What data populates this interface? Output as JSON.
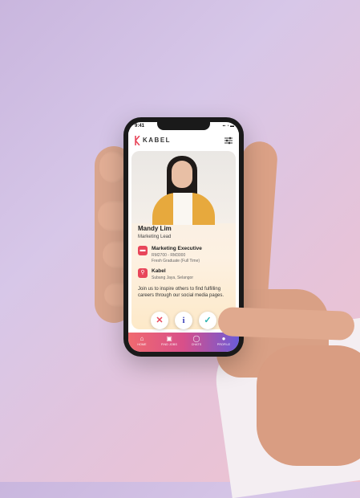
{
  "status_bar": {
    "time": "9:41",
    "icons": "▪▪ ◔ ▬"
  },
  "header": {
    "logo_text": "KABEL",
    "logo_icon": "kabel-logo-icon",
    "filter_icon": "filter-sliders-icon"
  },
  "profile": {
    "name": "Mandy Lim",
    "role": "Marketing Lead",
    "job": {
      "icon": "briefcase-icon",
      "title": "Marketing Executive",
      "salary": "RM2700 - RM3000",
      "type": "Fresh Graduate (Full Time)"
    },
    "company": {
      "icon": "location-pin-icon",
      "name": "Kabel",
      "location": "Subang Jaya, Selangor"
    },
    "description": "Join us to inspire others to find fulfilling careers through our social media pages."
  },
  "actions": [
    {
      "name": "reject",
      "glyph": "✕",
      "color": "#e8465a"
    },
    {
      "name": "info",
      "glyph": "i",
      "color": "#3a3fb8"
    },
    {
      "name": "accept",
      "glyph": "✓",
      "color": "#2bb3b0"
    }
  ],
  "nav": [
    {
      "label": "HOME",
      "icon": "home-icon",
      "glyph": "⌂"
    },
    {
      "label": "FIND JOBS",
      "icon": "find-jobs-icon",
      "glyph": "▣"
    },
    {
      "label": "CHATS",
      "icon": "chat-icon",
      "glyph": "◯"
    },
    {
      "label": "PROFILE",
      "icon": "profile-icon",
      "glyph": "●"
    }
  ],
  "colors": {
    "accent": "#e8465a",
    "nav_start": "#f06a6f",
    "nav_end": "#6a5bd8"
  }
}
